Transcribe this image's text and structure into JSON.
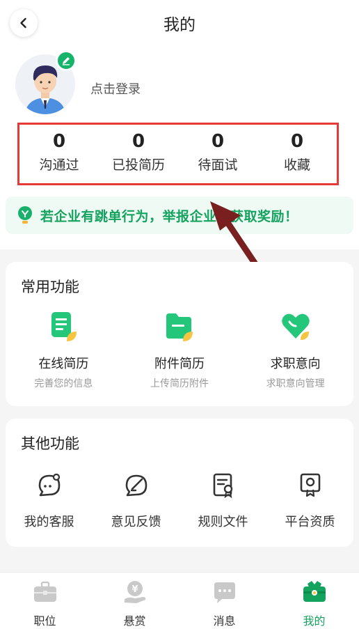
{
  "header": {
    "title": "我的"
  },
  "profile": {
    "login_text": "点击登录"
  },
  "stats": [
    {
      "value": "0",
      "label": "沟通过"
    },
    {
      "value": "0",
      "label": "已投简历"
    },
    {
      "value": "0",
      "label": "待面试"
    },
    {
      "value": "0",
      "label": "收藏"
    }
  ],
  "notice": {
    "text": "若企业有跳单行为，举报企业可获取奖励！"
  },
  "common": {
    "title": "常用功能",
    "items": [
      {
        "label": "在线简历",
        "sub": "完善您的信息",
        "icon": "resume-icon"
      },
      {
        "label": "附件简历",
        "sub": "上传简历附件",
        "icon": "folder-icon"
      },
      {
        "label": "求职意向",
        "sub": "求职意向管理",
        "icon": "heart-icon"
      }
    ]
  },
  "other": {
    "title": "其他功能",
    "items": [
      {
        "label": "我的客服",
        "icon": "customer-service-icon"
      },
      {
        "label": "意见反馈",
        "icon": "feedback-icon"
      },
      {
        "label": "规则文件",
        "icon": "rules-document-icon"
      },
      {
        "label": "平台资质",
        "icon": "certificate-icon"
      }
    ]
  },
  "tabbar": {
    "items": [
      {
        "label": "职位",
        "icon": "briefcase-icon"
      },
      {
        "label": "悬赏",
        "icon": "reward-icon"
      },
      {
        "label": "消息",
        "icon": "message-icon"
      },
      {
        "label": "我的",
        "icon": "profile-wallet-icon"
      }
    ],
    "active": "我的"
  },
  "colors": {
    "accent": "#14a35f",
    "highlight_box": "#e53935",
    "annotation_arrow": "#7a1f1f"
  }
}
